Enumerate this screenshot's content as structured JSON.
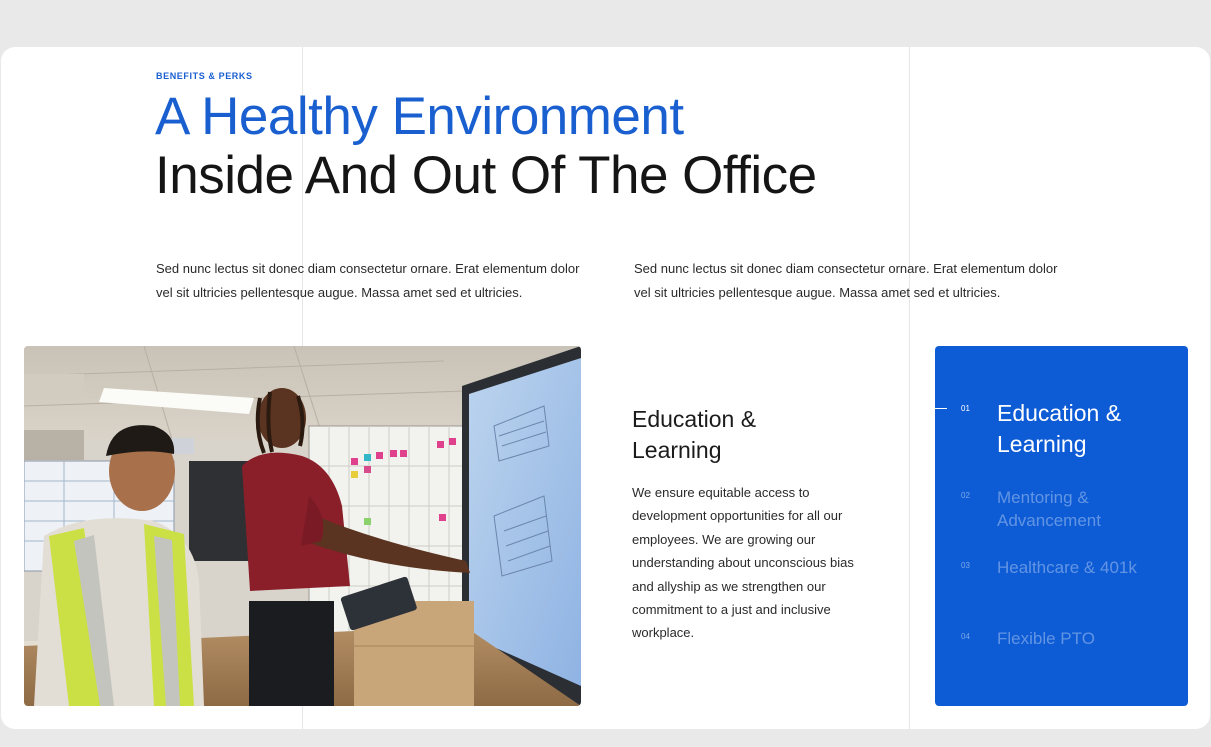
{
  "section": {
    "eyebrow": "BENEFITS & PERKS",
    "headline_line1": "A Healthy Environment",
    "headline_line2": "Inside And Out Of The Office"
  },
  "intro": {
    "paragraph_left": "Sed nunc lectus sit donec diam consectetur ornare. Erat elementum dolor vel sit ultricies pellentesque augue. Massa amet sed et ultricies.",
    "paragraph_right": "Sed nunc lectus sit donec diam consectetur ornare. Erat elementum dolor vel sit ultricies pellentesque augue. Massa amet sed et ultricies."
  },
  "feature": {
    "title": "Education & Learning",
    "body": "We ensure equitable access to development opportunities for all our employees. We are growing our understanding about unconscious bias and allyship as we strengthen our commitment to a just and inclusive workplace."
  },
  "benefits_nav": {
    "items": [
      {
        "number": "01",
        "label": "Education & Learning",
        "active": true
      },
      {
        "number": "02",
        "label": "Mentoring & Advancement",
        "active": false
      },
      {
        "number": "03",
        "label": "Healthcare & 401k",
        "active": false
      },
      {
        "number": "04",
        "label": "Flexible PTO",
        "active": false
      }
    ]
  },
  "colors": {
    "accent": "#1a5fd0",
    "panel": "#0d5bd5",
    "background": "#e9e9e9"
  }
}
